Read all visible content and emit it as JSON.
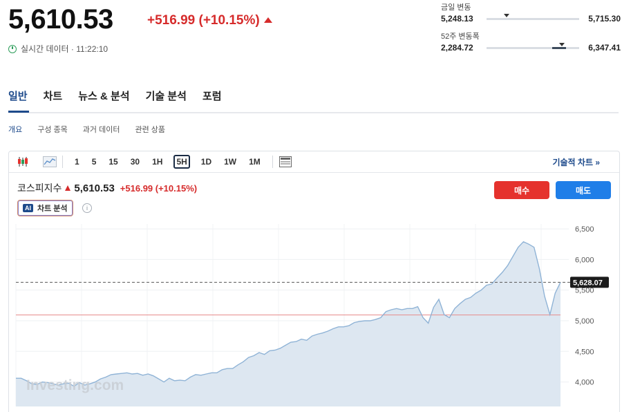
{
  "header": {
    "price": "5,610.53",
    "change": "+516.99 (+10.15%)",
    "realtime_label": "실시간 데이터 · 11:22:10"
  },
  "ranges": {
    "day": {
      "label": "금일 변동",
      "low": "5,248.13",
      "high": "5,715.30",
      "position": 0.22
    },
    "week52": {
      "label": "52주 변동폭",
      "low": "2,284.72",
      "high": "6,347.41",
      "position": 0.81
    }
  },
  "tabs": [
    "일반",
    "차트",
    "뉴스 & 분석",
    "기술 분석",
    "포럼"
  ],
  "subtabs": [
    "개요",
    "구성 종목",
    "과거 데이터",
    "관련 상품"
  ],
  "toolbar": {
    "timeframes": [
      "1",
      "5",
      "15",
      "30",
      "1H",
      "5H",
      "1D",
      "1W",
      "1M"
    ],
    "active_timeframe": "5H",
    "technical_link": "기술적 차트 »"
  },
  "index": {
    "name": "코스피지수",
    "price": "5,610.53",
    "change": "+516.99 (+10.15%)"
  },
  "ai_button": {
    "badge": "AI",
    "label": "차트 분석"
  },
  "trade": {
    "buy": "매수",
    "sell": "매도"
  },
  "chart_data": {
    "type": "area",
    "y_ticks": [
      "6,500",
      "6,000",
      "5,500",
      "5,000",
      "4,500",
      "4,000"
    ],
    "ylim": [
      3600,
      6580
    ],
    "current_label": "5,628.07",
    "current_value": 5628.07,
    "reference_value": 5094,
    "watermark": "Investing.com",
    "values": [
      4060,
      4060,
      4020,
      3970,
      3960,
      4000,
      3990,
      3970,
      3950,
      3970,
      3980,
      3930,
      3990,
      3950,
      3970,
      4000,
      4050,
      4080,
      4120,
      4130,
      4140,
      4150,
      4130,
      4140,
      4110,
      4130,
      4100,
      4050,
      4000,
      4060,
      4020,
      4030,
      4020,
      4080,
      4120,
      4110,
      4130,
      4150,
      4150,
      4200,
      4220,
      4220,
      4280,
      4330,
      4400,
      4430,
      4480,
      4450,
      4510,
      4520,
      4550,
      4600,
      4650,
      4660,
      4700,
      4680,
      4750,
      4780,
      4800,
      4830,
      4870,
      4900,
      4900,
      4920,
      4970,
      4990,
      5000,
      5000,
      5020,
      5050,
      5150,
      5180,
      5200,
      5180,
      5200,
      5200,
      5230,
      5050,
      4960,
      5220,
      5350,
      5100,
      5050,
      5200,
      5280,
      5350,
      5380,
      5450,
      5500,
      5580,
      5600,
      5700,
      5790,
      5900,
      6050,
      6200,
      6290,
      6250,
      6200,
      5850,
      5400,
      5100,
      5450,
      5628
    ]
  }
}
